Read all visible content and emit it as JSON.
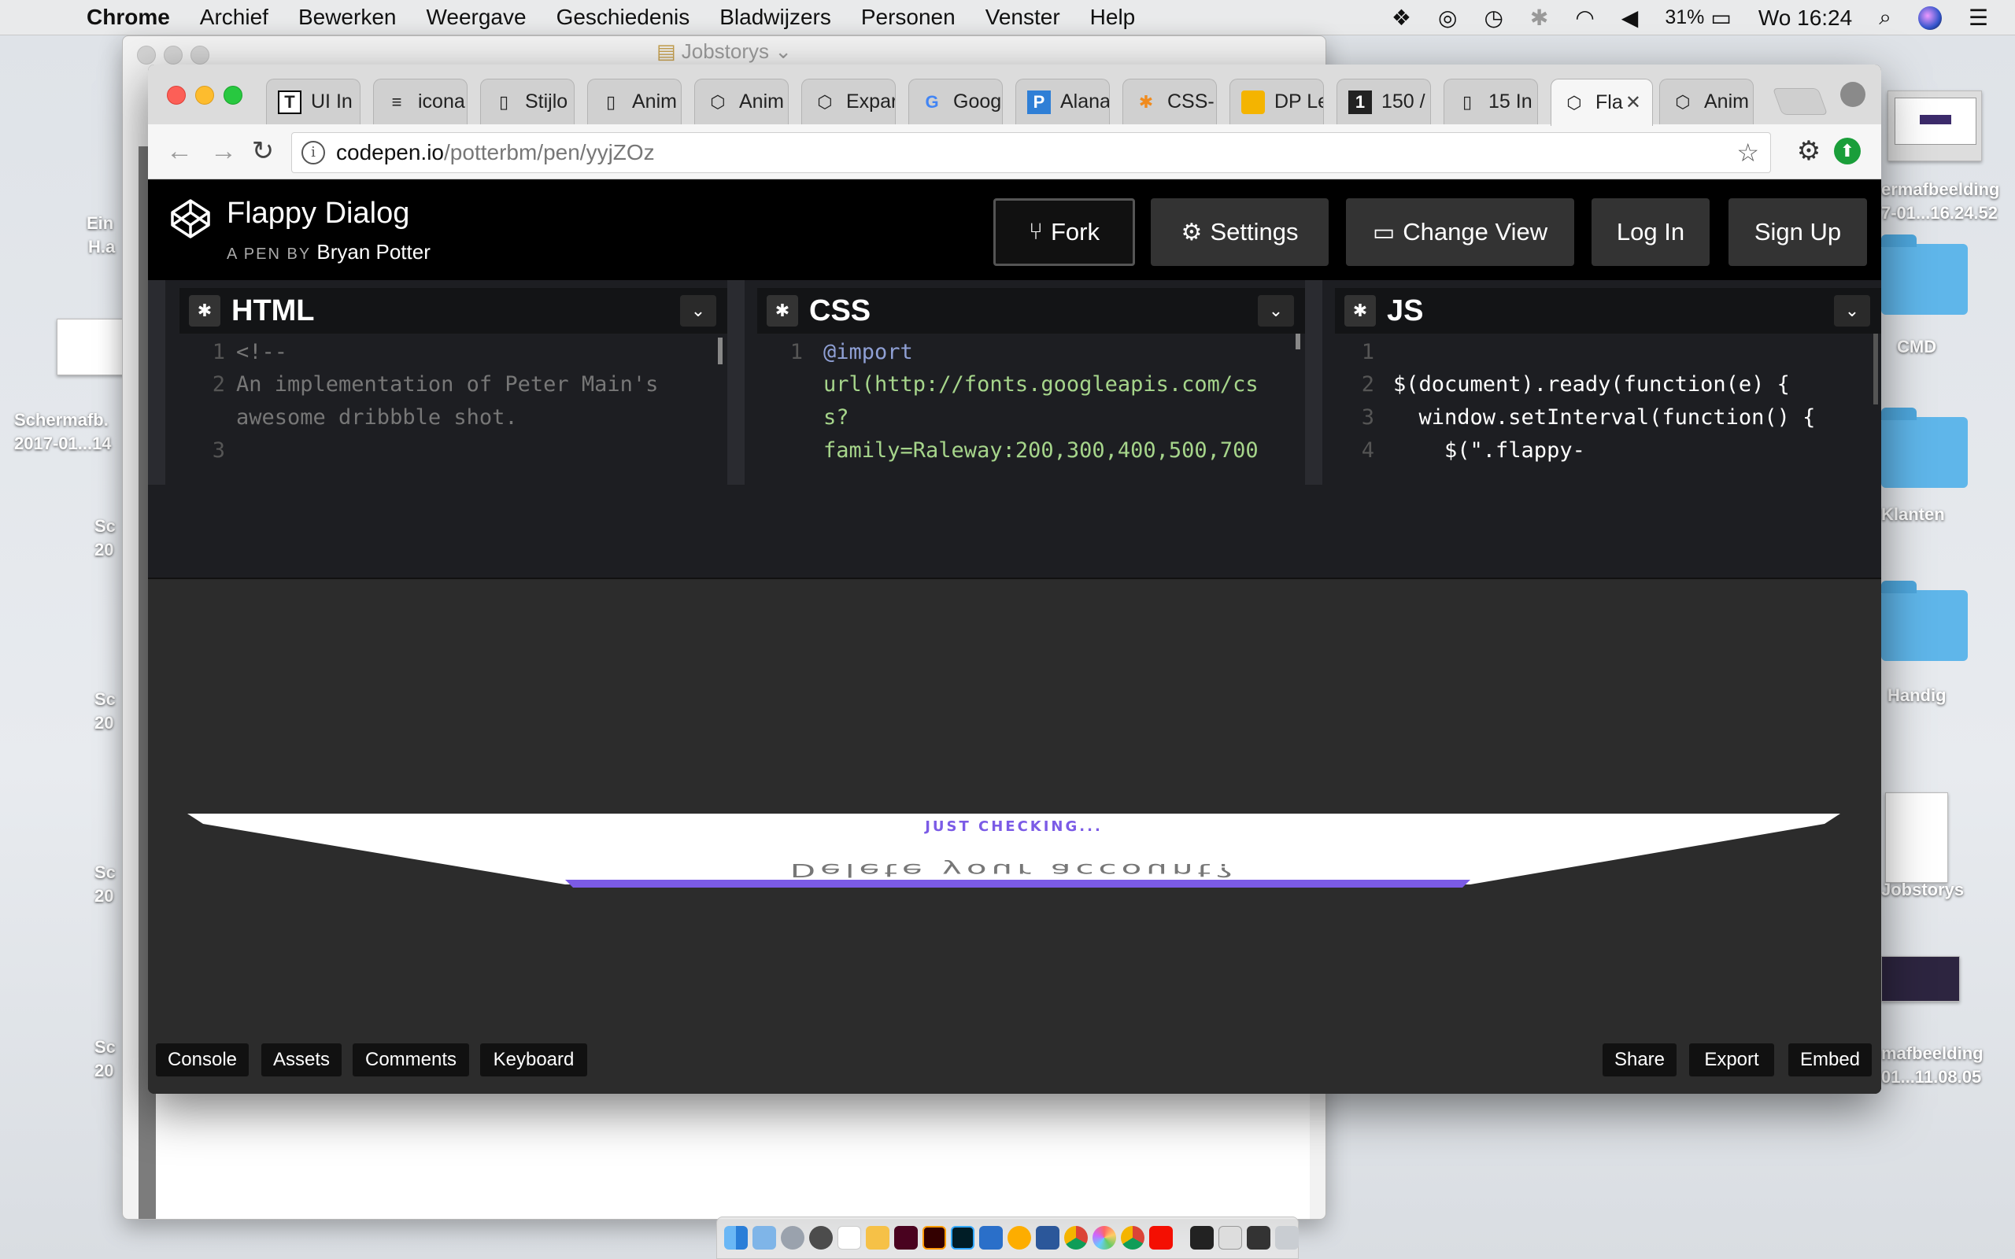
{
  "menubar": {
    "app": "Chrome",
    "items": [
      "Archief",
      "Bewerken",
      "Weergave",
      "Geschiedenis",
      "Bladwijzers",
      "Personen",
      "Venster",
      "Help"
    ],
    "battery": "31%",
    "clock": "Wo 16:24"
  },
  "desktop": {
    "labels": [
      {
        "text": "Ein"
      },
      {
        "text": "H.a"
      },
      {
        "text": "Schermafb."
      },
      {
        "text": "2017-01...14"
      },
      {
        "text": "Sc"
      },
      {
        "text": "20"
      },
      {
        "text": "Sc"
      },
      {
        "text": "20"
      },
      {
        "text": "Sc"
      },
      {
        "text": "20"
      },
      {
        "text": "Sc"
      },
      {
        "text": "20"
      },
      {
        "text": "ermafbeelding"
      },
      {
        "text": "7-01...16.24.52"
      },
      {
        "text": "CMD"
      },
      {
        "text": "Klanten"
      },
      {
        "text": "Handig"
      },
      {
        "text": "Jobstorys"
      },
      {
        "text": "mafbeelding"
      },
      {
        "text": "01...11.08.05"
      }
    ]
  },
  "back_window": {
    "title": "Jobstorys"
  },
  "chrome": {
    "tabs": [
      {
        "label": "UI In",
        "icon": "T"
      },
      {
        "label": "icona",
        "icon": "≡"
      },
      {
        "label": "Stijlo",
        "icon": "doc"
      },
      {
        "label": "Anim",
        "icon": "doc"
      },
      {
        "label": "Anim",
        "icon": "codepen"
      },
      {
        "label": "Expar",
        "icon": "codepen"
      },
      {
        "label": "Goog",
        "icon": "G"
      },
      {
        "label": "Alana",
        "icon": "P"
      },
      {
        "label": "CSS-",
        "icon": "*"
      },
      {
        "label": "DP Le",
        "icon": "slides"
      },
      {
        "label": "150 /",
        "icon": "1"
      },
      {
        "label": "15 In",
        "icon": "doc"
      },
      {
        "label": "Fla",
        "icon": "codepen"
      },
      {
        "label": "Anim",
        "icon": "codepen"
      }
    ],
    "active_tab": 12,
    "url_host": "codepen.io",
    "url_path": "/potterbm/pen/yyjZOz"
  },
  "codepen": {
    "title": "Flappy Dialog",
    "byline": "A PEN BY",
    "author": "Bryan Potter",
    "buttons": {
      "fork": "Fork",
      "settings": "Settings",
      "change_view": "Change View",
      "login": "Log In",
      "signup": "Sign Up"
    },
    "editors": {
      "html": {
        "name": "HTML",
        "lines": [
          {
            "n": "1",
            "text": "<!--"
          },
          {
            "n": "2",
            "text": "An implementation of Peter Main's"
          },
          {
            "n": "",
            "text": "awesome dribbble shot."
          },
          {
            "n": "3",
            "text": ""
          }
        ]
      },
      "css": {
        "name": "CSS",
        "lines": [
          {
            "n": "1",
            "text": "@import"
          },
          {
            "n": "",
            "text": "url(http://fonts.googleapis.com/cs"
          },
          {
            "n": "",
            "text": "s?"
          },
          {
            "n": "",
            "text": "family=Raleway:200,300,400,500,700"
          }
        ]
      },
      "js": {
        "name": "JS",
        "lines": [
          {
            "n": "1",
            "text": ""
          },
          {
            "n": "2",
            "text": "$(document).ready(function(e) {"
          },
          {
            "n": "3",
            "text": "  window.setInterval(function() {"
          },
          {
            "n": "4",
            "text": "    $(\".flappy-"
          }
        ]
      }
    },
    "dialog": {
      "kicker": "JUST CHECKING...",
      "heading": "Delete your account?"
    },
    "footer": {
      "console": "Console",
      "assets": "Assets",
      "comments": "Comments",
      "keyboard": "Keyboard",
      "share": "Share",
      "export": "Export",
      "embed": "Embed"
    }
  },
  "colors": {
    "accent_purple": "#7b5be6",
    "codepen_black": "#000000",
    "button_gray": "#333333"
  }
}
